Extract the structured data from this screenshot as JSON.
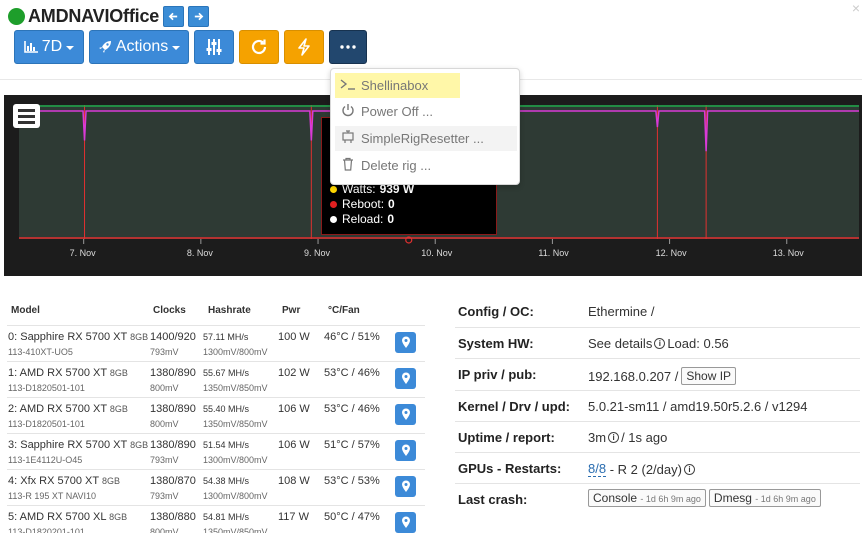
{
  "header": {
    "title": "AMDNAVIOffice",
    "status_color": "#1e9e2b",
    "back_icon": "arrow-left-icon",
    "forward_icon": "arrow-right-icon"
  },
  "toolbar": {
    "period_label": "7D",
    "actions_label": "Actions"
  },
  "dropdown": {
    "items": [
      {
        "label": "Shellinabox",
        "icon": "terminal-icon"
      },
      {
        "label": "Power Off ...",
        "icon": "power-icon"
      },
      {
        "label": "SimpleRigResetter ...",
        "icon": "reset-device-icon"
      },
      {
        "label": "Delete rig ...",
        "icon": "trash-icon"
      }
    ]
  },
  "chart_data": {
    "type": "line",
    "x_ticks": [
      "7. Nov",
      "8. Nov",
      "9. Nov",
      "10. Nov",
      "11. Nov",
      "12. Nov",
      "13. Nov"
    ],
    "series": [
      {
        "color": "#1fa84a"
      },
      {
        "color": "#d93ad6"
      },
      {
        "color": "#e03030"
      }
    ],
    "dips": [
      {
        "x": 0.078,
        "depth": 0.22
      },
      {
        "x": 0.348,
        "depth": 0.22
      },
      {
        "x": 0.76,
        "depth": 0.12
      },
      {
        "x": 0.818,
        "depth": 0.3
      }
    ],
    "reboot_lines": [
      0.078,
      0.348,
      0.76,
      0.818
    ],
    "marker_x": 0.464,
    "tooltip": [
      {
        "label": "Watts:",
        "value": "939 W",
        "color": "#ffd700"
      },
      {
        "label": "Reboot:",
        "value": "0",
        "color": "#e02020"
      },
      {
        "label": "Reload:",
        "value": "0",
        "color": "#ffffff"
      }
    ]
  },
  "gpu_table": {
    "headers": [
      "Model",
      "Clocks",
      "Hashrate",
      "Pwr",
      "°C/Fan"
    ],
    "rows": [
      {
        "name": "0: Sapphire RX 5700 XT",
        "mem": "8GB",
        "id": "113-410XT-UO5",
        "clocks": "1400/920",
        "clock_mem": "793mV",
        "hash": "57.11 MH/s",
        "hash_sub": "1300mV/800mV",
        "pwr": "100 W",
        "temp": "46°C / 51%"
      },
      {
        "name": "1: AMD RX 5700 XT",
        "mem": "8GB",
        "id": "113-D1820501-101",
        "clocks": "1380/890",
        "clock_mem": "800mV",
        "hash": "55.67 MH/s",
        "hash_sub": "1350mV/850mV",
        "pwr": "102 W",
        "temp": "53°C / 46%"
      },
      {
        "name": "2: AMD RX 5700 XT",
        "mem": "8GB",
        "id": "113-D1820501-101",
        "clocks": "1380/890",
        "clock_mem": "800mV",
        "hash": "55.40 MH/s",
        "hash_sub": "1350mV/850mV",
        "pwr": "106 W",
        "temp": "53°C / 46%"
      },
      {
        "name": "3: Sapphire RX 5700 XT",
        "mem": "8GB",
        "id": "113-1E4112U-O45",
        "clocks": "1380/890",
        "clock_mem": "793mV",
        "hash": "51.54 MH/s",
        "hash_sub": "1300mV/800mV",
        "pwr": "106 W",
        "temp": "51°C / 57%"
      },
      {
        "name": "4: Xfx RX 5700 XT",
        "mem": "8GB",
        "id": "113-R 195 XT NAVI10",
        "clocks": "1380/870",
        "clock_mem": "793mV",
        "hash": "54.38 MH/s",
        "hash_sub": "1300mV/800mV",
        "pwr": "108 W",
        "temp": "53°C / 53%"
      },
      {
        "name": "5: AMD RX 5700 XL",
        "mem": "8GB",
        "id": "113-D1820201-101",
        "clocks": "1380/880",
        "clock_mem": "800mV",
        "hash": "54.81 MH/s",
        "hash_sub": "1350mV/850mV",
        "pwr": "117 W",
        "temp": "50°C / 47%"
      }
    ]
  },
  "info": {
    "config_label": "Config / OC:",
    "config_value": "Ethermine /",
    "hw_label": "System HW:",
    "hw_value": "See details",
    "hw_load": "Load: 0.56",
    "ip_label": "IP priv / pub:",
    "ip_value": "192.168.0.207 /",
    "ip_btn": "Show IP",
    "kernel_label": "Kernel / Drv / upd:",
    "kernel_value": "5.0.21-sm11 / amd19.50r5.2.6 / v1294",
    "uptime_label": "Uptime / report:",
    "uptime_value": "3m",
    "uptime_report": "/ 1s ago",
    "gpus_label": "GPUs - Restarts:",
    "gpus_link": "8/8",
    "gpus_rest": "- R 2 (2/day)",
    "crash_label": "Last crash:",
    "crash_console": "Console",
    "crash_console_ago": "- 1d 6h 9m ago",
    "crash_dmesg": "Dmesg",
    "crash_dmesg_ago": "- 1d 6h 9m ago"
  }
}
